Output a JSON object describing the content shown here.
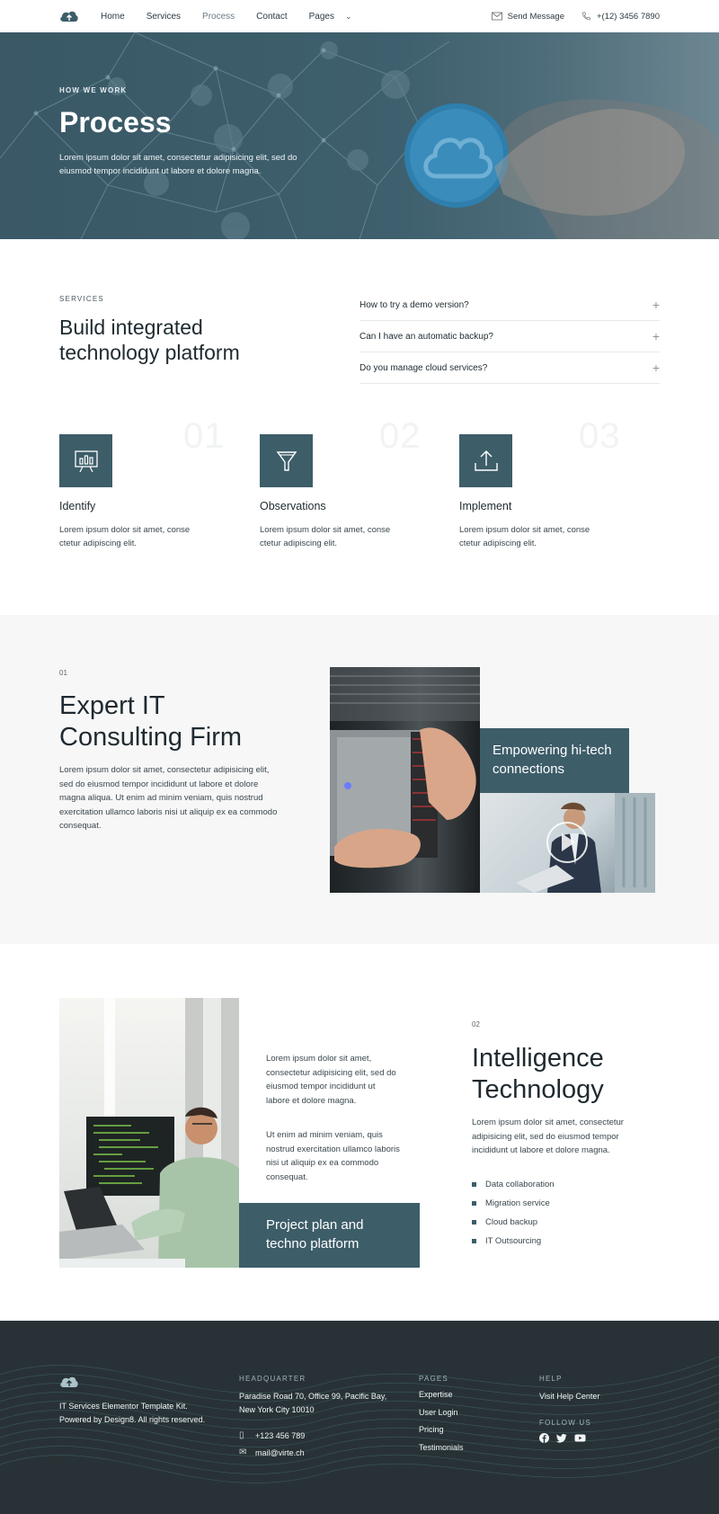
{
  "nav": {
    "links": [
      "Home",
      "Services",
      "Process",
      "Contact",
      "Pages"
    ],
    "active": "Process",
    "message_label": "Send Message",
    "phone": "+(12) 3456 7890"
  },
  "hero": {
    "kicker": "HOW WE WORK",
    "title": "Process",
    "description": "Lorem ipsum dolor sit amet, consectetur adipisicing elit, sed do eiusmod tempor incididunt ut labore et dolore magna."
  },
  "services": {
    "kicker": "SERVICES",
    "title": "Build integrated technology platform",
    "faq": [
      "How to try a demo version?",
      "Can I have an automatic backup?",
      "Do you manage cloud services?"
    ],
    "features": [
      {
        "number": "01",
        "name": "Identify",
        "text": "Lorem ipsum dolor sit amet, conse ctetur adipiscing elit.",
        "icon": "presentation-chart-icon"
      },
      {
        "number": "02",
        "name": "Observations",
        "text": "Lorem ipsum dolor sit amet, conse ctetur adipiscing elit.",
        "icon": "funnel-icon"
      },
      {
        "number": "03",
        "name": "Implement",
        "text": "Lorem ipsum dolor sit amet, conse ctetur adipiscing elit.",
        "icon": "upload-icon"
      }
    ]
  },
  "expert": {
    "number": "01",
    "title": "Expert IT Consulting Firm",
    "description": "Lorem ipsum dolor sit amet, consectetur adipisicing elit, sed do eiusmod tempor incididunt ut labore et dolore magna aliqua. Ut enim ad minim veniam, quis nostrud exercitation ullamco laboris nisi ut aliquip ex ea commodo consequat.",
    "card": "Empowering hi-tech connections"
  },
  "intelligence": {
    "para1": "Lorem ipsum dolor sit amet, consectetur adipisicing elit, sed do eiusmod tempor incididunt ut labore et dolore magna.",
    "para2": "Ut enim ad minim veniam, quis nostrud exercitation ullamco laboris nisi ut aliquip ex ea commodo consequat.",
    "card": "Project plan and techno platform",
    "number": "02",
    "title": "Intelligence Technology",
    "description": "Lorem ipsum dolor sit amet, consectetur adipisicing elit, sed do eiusmod tempor incididunt ut labore et dolore magna.",
    "list": [
      "Data collaboration",
      "Migration service",
      "Cloud backup",
      "IT Outsourcing"
    ]
  },
  "footer": {
    "about": "IT Services Elementor Template Kit. Powered by Design8. All rights reserved.",
    "hq_heading": "HEADQUARTER",
    "address": "Paradise Road 70, Office 99, Pacific Bay,  New York City 10010",
    "phone": "+123 456 789",
    "email": "mail@virte.ch",
    "pages_heading": "PAGES",
    "pages": [
      "Expertise",
      "User Login",
      "Pricing",
      "Testimonials"
    ],
    "help_heading": "HELP",
    "help_link": "Visit Help Center",
    "follow_heading": "FOLLOW US",
    "social_icons": [
      "facebook-icon",
      "twitter-icon",
      "youtube-icon"
    ]
  },
  "colors": {
    "accent": "#3d5d69",
    "footer_bg": "#283236",
    "section_bg": "#f7f7f7"
  }
}
